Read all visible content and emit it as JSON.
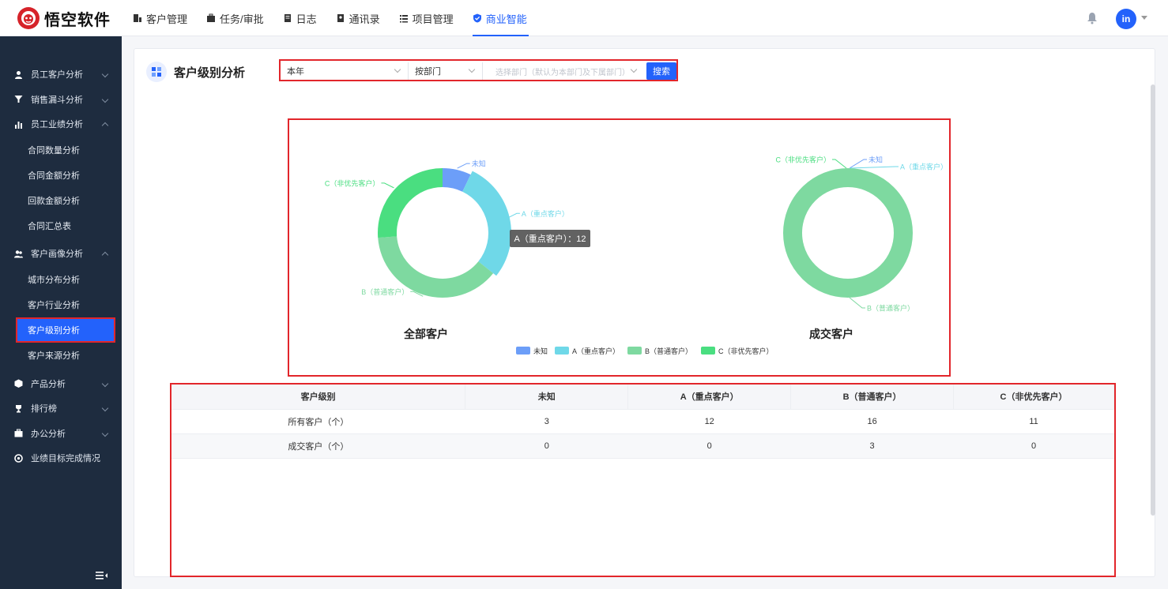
{
  "app": {
    "logo_text": "悟空软件",
    "avatar_text": "in"
  },
  "nav": [
    {
      "label": "客户管理",
      "icon": "building-icon"
    },
    {
      "label": "任务/审批",
      "icon": "briefcase-icon"
    },
    {
      "label": "日志",
      "icon": "log-icon"
    },
    {
      "label": "通讯录",
      "icon": "address-book-icon"
    },
    {
      "label": "项目管理",
      "icon": "project-icon"
    },
    {
      "label": "商业智能",
      "icon": "shield-check-icon",
      "active": true
    }
  ],
  "sidebar": {
    "groups": [
      {
        "label": "员工客户分析",
        "icon": "user-icon",
        "expanded": false
      },
      {
        "label": "销售漏斗分析",
        "icon": "funnel-icon",
        "expanded": false
      },
      {
        "label": "员工业绩分析",
        "icon": "bar-chart-icon",
        "expanded": true,
        "children": [
          "合同数量分析",
          "合同金额分析",
          "回款金额分析",
          "合同汇总表"
        ]
      },
      {
        "label": "客户画像分析",
        "icon": "users-icon",
        "expanded": true,
        "children": [
          "城市分布分析",
          "客户行业分析",
          "客户级别分析",
          "客户来源分析"
        ]
      },
      {
        "label": "产品分析",
        "icon": "box-icon",
        "expanded": false
      },
      {
        "label": "排行榜",
        "icon": "trophy-icon",
        "expanded": false
      },
      {
        "label": "办公分析",
        "icon": "briefcase-icon",
        "expanded": false
      },
      {
        "label": "业绩目标完成情况",
        "icon": "target-icon",
        "expanded": null
      }
    ],
    "active_child": "客户级别分析"
  },
  "page": {
    "title": "客户级别分析"
  },
  "filters": {
    "period": "本年",
    "scope": "按部门",
    "dept_placeholder": "选择部门（默认为本部门及下属部门）",
    "search_label": "搜索"
  },
  "colors": {
    "unknown": "#6c9ef8",
    "a": "#6fd8e8",
    "b": "#7ed9a0",
    "c": "#4ade80",
    "accent": "#2362fb",
    "highlight": "#e2262b"
  },
  "chart_data": [
    {
      "type": "pie",
      "title": "全部客户",
      "categories": [
        "未知",
        "A（重点客户）",
        "B（普通客户）",
        "C（非优先客户）"
      ],
      "values": [
        3,
        12,
        16,
        11
      ],
      "tooltip": "A（重点客户）：12",
      "legend": "bottom"
    },
    {
      "type": "pie",
      "title": "成交客户",
      "categories": [
        "未知",
        "A（重点客户）",
        "B（普通客户）",
        "C（非优先客户）"
      ],
      "values": [
        0,
        0,
        3,
        0
      ],
      "legend": "bottom"
    }
  ],
  "table": {
    "headers": [
      "客户级别",
      "未知",
      "A（重点客户）",
      "B（普通客户）",
      "C（非优先客户）"
    ],
    "rows": [
      [
        "所有客户（个）",
        "3",
        "12",
        "16",
        "11"
      ],
      [
        "成交客户（个）",
        "0",
        "0",
        "3",
        "0"
      ]
    ]
  }
}
